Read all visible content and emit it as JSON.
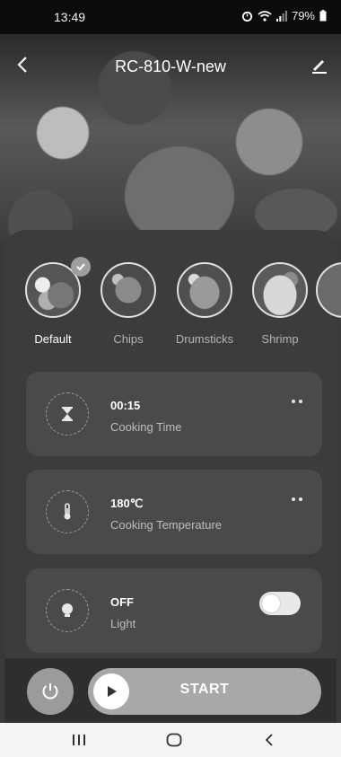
{
  "status_bar": {
    "time": "13:49",
    "battery": "79%"
  },
  "header": {
    "title": "RC-810-W-new"
  },
  "modes": [
    {
      "label": "Default",
      "active": true
    },
    {
      "label": "Chips",
      "active": false
    },
    {
      "label": "Drumsticks",
      "active": false
    },
    {
      "label": "Shrimp",
      "active": false
    }
  ],
  "cooking_time": {
    "value": "00:15",
    "label": "Cooking Time"
  },
  "cooking_temperature": {
    "value": "180℃",
    "label": "Cooking Temperature"
  },
  "light": {
    "value": "OFF",
    "label": "Light",
    "on": false
  },
  "actions": {
    "start_label": "START"
  },
  "colors": {
    "background": "#3c3c3c",
    "card": "#4a4a4a",
    "start_button": "#a8a8a8"
  }
}
